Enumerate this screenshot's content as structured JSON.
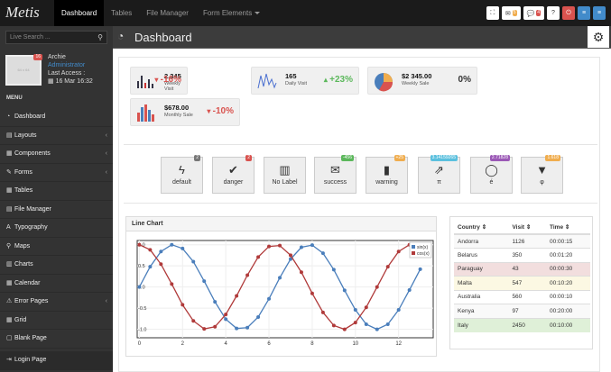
{
  "brand": "Metis",
  "nav": [
    {
      "label": "Dashboard",
      "active": true
    },
    {
      "label": "Tables"
    },
    {
      "label": "File Manager"
    },
    {
      "label": "Form Elements",
      "caret": true
    }
  ],
  "toolbar": {
    "buttons": [
      {
        "name": "fullscreen",
        "glyph": "⛶"
      },
      {
        "name": "messages",
        "glyph": "✉",
        "badge": "5",
        "badgeColor": "#f0ad4e"
      },
      {
        "name": "comments",
        "glyph": "💬",
        "badge": "4",
        "badgeColor": "#d9534f"
      },
      {
        "name": "help",
        "glyph": "?"
      },
      {
        "name": "power",
        "glyph": "⏻",
        "bg": "#d9534f"
      },
      {
        "name": "menu-a",
        "glyph": "≡",
        "bg": "#428bca"
      },
      {
        "name": "menu-b",
        "glyph": "≡",
        "bg": "#428bca"
      }
    ]
  },
  "search": {
    "placeholder": "Live Search ..."
  },
  "user": {
    "badge": "16",
    "avatar": "64 x 64",
    "name": "Archie",
    "role": "Administrator",
    "last_label": "Last Access :",
    "last_date": "16 Mar 16:32"
  },
  "menu_header": "MENU",
  "menu": [
    {
      "label": "Dashboard",
      "icon": "dashboard-icon",
      "glyph": "◔"
    },
    {
      "label": "Layouts",
      "icon": "layout-icon",
      "glyph": "▤",
      "chev": true
    },
    {
      "label": "Components",
      "icon": "tasks-icon",
      "glyph": "▦",
      "chev": true
    },
    {
      "label": "Forms",
      "icon": "pencil-icon",
      "glyph": "✎",
      "chev": true
    },
    {
      "label": "Tables",
      "icon": "table-icon",
      "glyph": "▦"
    },
    {
      "label": "File Manager",
      "icon": "file-icon",
      "glyph": "▤"
    },
    {
      "label": "Typography",
      "icon": "font-icon",
      "glyph": "A"
    },
    {
      "label": "Maps",
      "icon": "map-marker-icon",
      "glyph": "⚲"
    },
    {
      "label": "Charts",
      "icon": "chart-icon",
      "glyph": "▥"
    },
    {
      "label": "Calendar",
      "icon": "calendar-icon",
      "glyph": "▦"
    },
    {
      "label": "Error Pages",
      "icon": "warning-icon",
      "glyph": "⚠",
      "chev": true
    },
    {
      "label": "Grid",
      "icon": "grid-icon",
      "glyph": "▦"
    },
    {
      "label": "Blank Page",
      "icon": "file-blank-icon",
      "glyph": "▢"
    }
  ],
  "login": "Login Page",
  "header": {
    "title": "Dashboard"
  },
  "stats": [
    {
      "value": "2.345",
      "label": "Weekly Visit",
      "pct": "-16%",
      "dir": "down"
    },
    {
      "value": "165",
      "label": "Daily Visit",
      "pct": "+23%",
      "dir": "up"
    },
    {
      "value": "$2 345.00",
      "label": "Weekly Sale",
      "pct": "0%",
      "dir": "none"
    },
    {
      "value": "$678.00",
      "label": "Monthly Sale",
      "pct": "-10%",
      "dir": "down"
    }
  ],
  "quick_buttons": [
    {
      "label": "default",
      "glyph": "ϟ",
      "badge": "2",
      "badgeColor": "#777"
    },
    {
      "label": "danger",
      "glyph": "✔",
      "badge": "2",
      "badgeColor": "#d9534f"
    },
    {
      "label": "No Label",
      "glyph": "▥"
    },
    {
      "label": "success",
      "glyph": "✉",
      "badge": "-456",
      "badgeColor": "#5cb85c"
    },
    {
      "label": "warning",
      "glyph": "▮",
      "badge": "+25",
      "badgeColor": "#f0ad4e"
    },
    {
      "label": "π",
      "glyph": "⇗",
      "badge": "3.14159265",
      "badgeColor": "#5bc0de"
    },
    {
      "label": "é",
      "glyph": "◯",
      "badge": "2.71828",
      "badgeColor": "#9b59b6"
    },
    {
      "label": "φ",
      "glyph": "▼",
      "badge": "1.618",
      "badgeColor": "#f0ad4e"
    }
  ],
  "chart_title": "Line Chart",
  "chart_data": {
    "type": "line",
    "x": [
      0,
      0.5,
      1,
      1.5,
      2,
      2.5,
      3,
      3.5,
      4,
      4.5,
      5,
      5.5,
      6,
      6.5,
      7,
      7.5,
      8,
      8.5,
      9,
      9.5,
      10,
      10.5,
      11,
      11.5,
      12,
      12.5,
      13
    ],
    "series": [
      {
        "name": "sin(x)",
        "color": "#4a7ebb",
        "values": [
          0,
          0.48,
          0.84,
          1.0,
          0.91,
          0.6,
          0.14,
          -0.35,
          -0.76,
          -0.98,
          -0.96,
          -0.71,
          -0.28,
          0.22,
          0.66,
          0.94,
          0.99,
          0.8,
          0.41,
          -0.08,
          -0.54,
          -0.88,
          -1.0,
          -0.88,
          -0.54,
          -0.07,
          0.42
        ]
      },
      {
        "name": "cos(x)",
        "color": "#b03a3a",
        "values": [
          1.0,
          0.88,
          0.54,
          0.07,
          -0.42,
          -0.8,
          -0.99,
          -0.94,
          -0.65,
          -0.21,
          0.28,
          0.71,
          0.96,
          0.98,
          0.75,
          0.35,
          -0.15,
          -0.6,
          -0.91,
          -1.0,
          -0.84,
          -0.48,
          0.0,
          0.48,
          0.84,
          1.0,
          0.91
        ]
      }
    ],
    "xlim": [
      -0.1,
      13.6
    ],
    "ylim": [
      -1.2,
      1.1
    ],
    "xticks": [
      "0",
      "2",
      "4",
      "6",
      "8",
      "10",
      "12"
    ],
    "yticks": [
      "1.0",
      "0.5",
      "0.0",
      "-0.5",
      "-1.0"
    ],
    "legend": "top-right",
    "grid": true
  },
  "table": {
    "headers": [
      "Country ⇕",
      "Visit ⇕",
      "Time ⇕"
    ],
    "rows": [
      {
        "c": "Andorra",
        "v": "1126",
        "t": "00:00:15",
        "bg": "#f9f9f9"
      },
      {
        "c": "Belarus",
        "v": "350",
        "t": "00:01:20",
        "bg": "#ffffff"
      },
      {
        "c": "Paraguay",
        "v": "43",
        "t": "00:00:30",
        "bg": "#f2dede"
      },
      {
        "c": "Malta",
        "v": "547",
        "t": "00:10:20",
        "bg": "#fcf8e3"
      },
      {
        "c": "Australia",
        "v": "560",
        "t": "00:00:10",
        "bg": "#ffffff"
      },
      {
        "c": "Kenya",
        "v": "97",
        "t": "00:20:00",
        "bg": "#f9f9f9"
      },
      {
        "c": "Italy",
        "v": "2450",
        "t": "00:10:00",
        "bg": "#dff0d8"
      }
    ]
  }
}
